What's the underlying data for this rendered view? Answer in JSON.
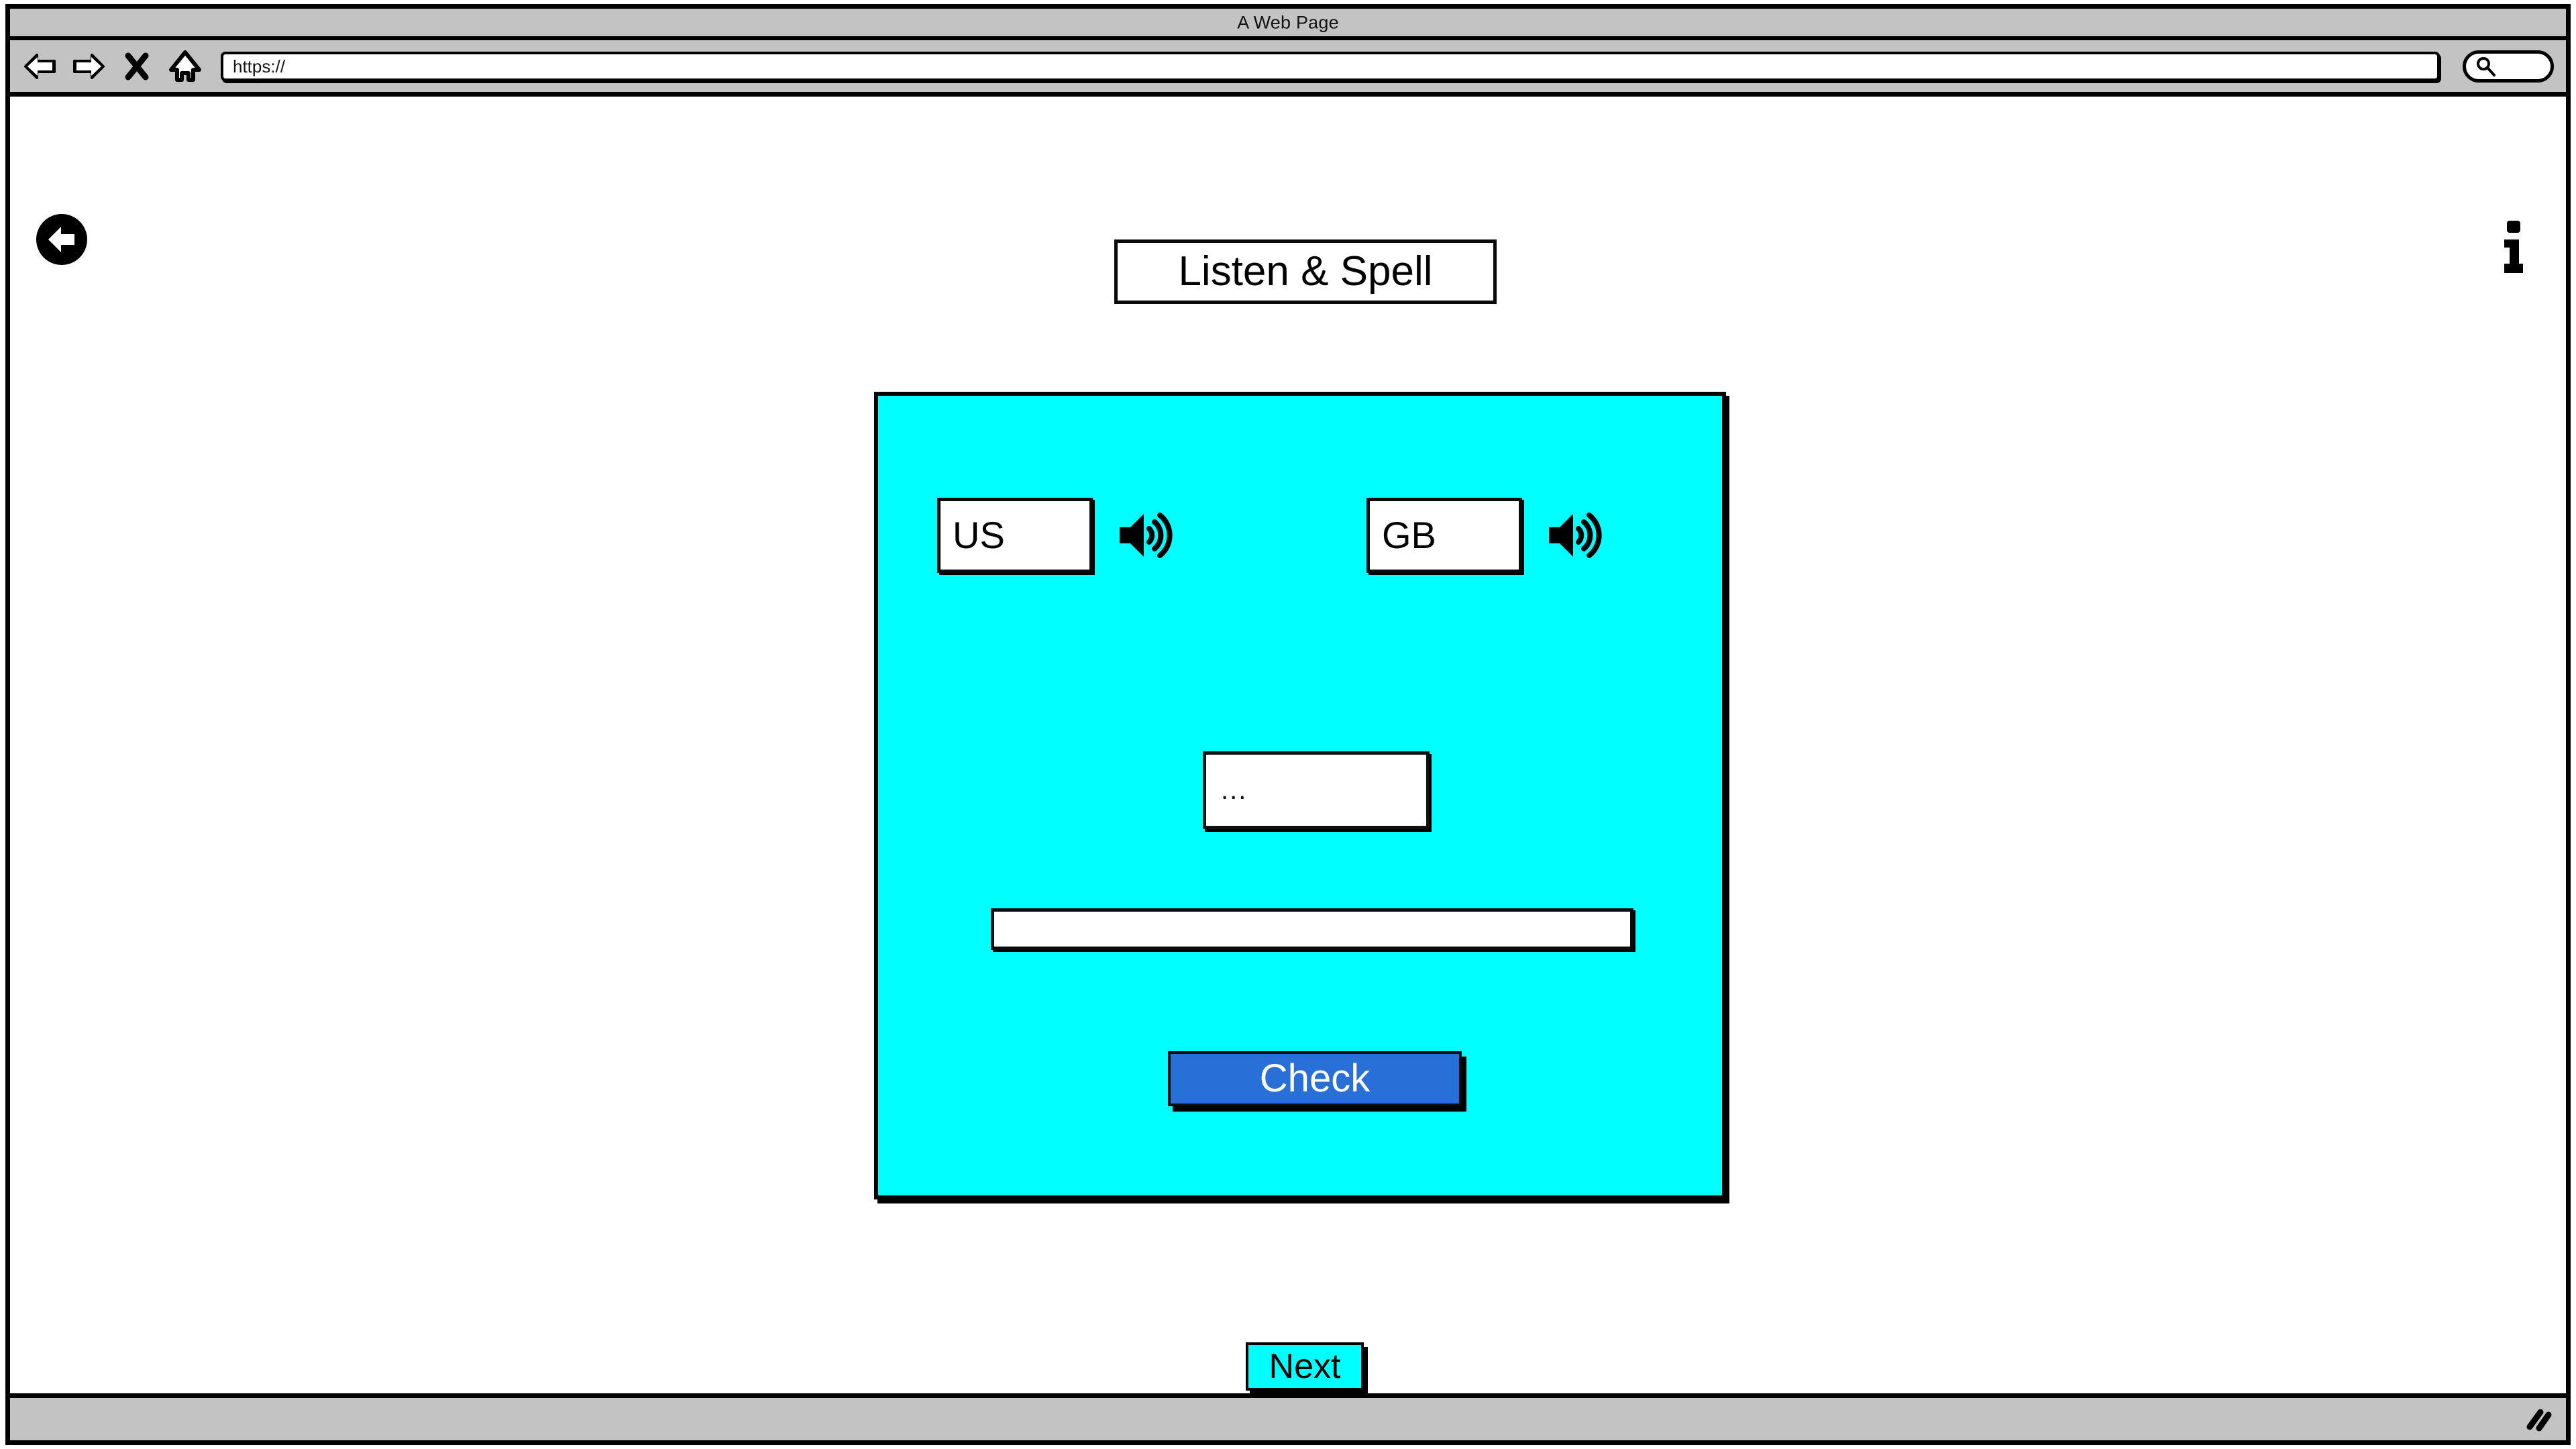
{
  "browser": {
    "window_title": "A Web Page",
    "url_value": "https://",
    "url_placeholder": "https://",
    "search_placeholder": "",
    "search_value": "",
    "nav": {
      "back_label": "Back",
      "forward_label": "Forward",
      "stop_label": "Stop",
      "home_label": "Home"
    },
    "icons": {
      "back": "back-arrow-icon",
      "forward": "forward-arrow-icon",
      "stop": "close-x-icon",
      "home": "home-icon",
      "search": "search-icon",
      "resize": "resize-grip-icon"
    }
  },
  "page": {
    "title": "Listen & Spell",
    "back_button_label": "",
    "info_button_label": "i",
    "icons": {
      "page_back": "circle-back-arrow-icon",
      "info": "info-icon"
    }
  },
  "exercise": {
    "voices": [
      {
        "accent_label": "US",
        "speaker_icon": "speaker-icon",
        "speaker_title": "Play US pronunciation"
      },
      {
        "accent_label": "GB",
        "speaker_icon": "speaker-icon",
        "speaker_title": "Play GB pronunciation"
      }
    ],
    "hint_text": "...",
    "answer_value": "",
    "answer_placeholder": "",
    "check_label": "Check"
  },
  "footer": {
    "next_label": "Next"
  },
  "colors": {
    "panel_background": "#00FFFF",
    "check_button": "#2870D8",
    "check_button_text": "#FFFFFF",
    "next_button": "#00FFFF",
    "chrome_gray": "#C3C3C3",
    "outline": "#000000",
    "page_background": "#FFFFFF"
  }
}
